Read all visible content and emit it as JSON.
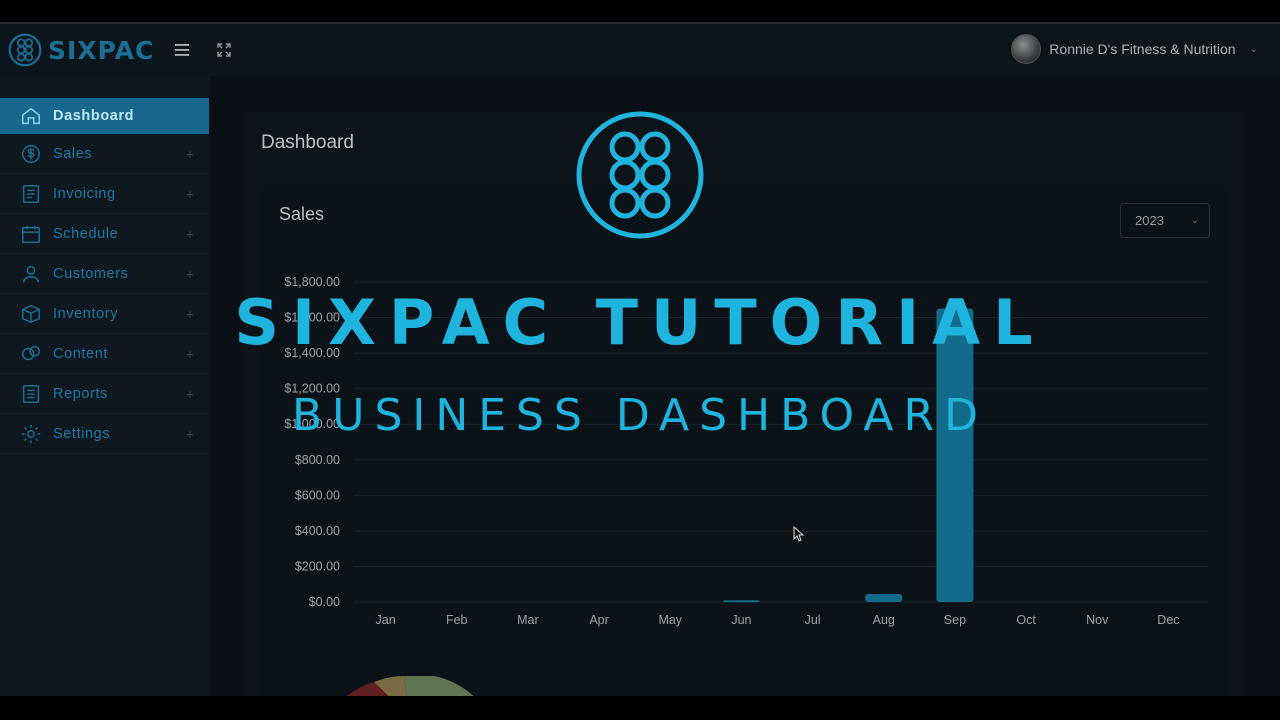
{
  "header": {
    "brand": "SIXPAC",
    "menu_icon": "hamburger-icon",
    "fullscreen_icon": "expand-icon",
    "user_name": "Ronnie D's Fitness & Nutrition"
  },
  "sidebar": {
    "items": [
      {
        "label": "Dashboard",
        "icon": "home-icon",
        "active": true
      },
      {
        "label": "Sales",
        "icon": "dollar-icon"
      },
      {
        "label": "Invoicing",
        "icon": "invoice-icon"
      },
      {
        "label": "Schedule",
        "icon": "calendar-icon"
      },
      {
        "label": "Customers",
        "icon": "user-icon"
      },
      {
        "label": "Inventory",
        "icon": "box-icon"
      },
      {
        "label": "Content",
        "icon": "content-icon"
      },
      {
        "label": "Reports",
        "icon": "report-icon"
      },
      {
        "label": "Settings",
        "icon": "gear-icon"
      }
    ],
    "expand_symbol": "+"
  },
  "main": {
    "page_title": "Dashboard",
    "sales_title": "Sales",
    "year": "2023"
  },
  "overlay": {
    "title": "SIXPAC TUTORIAL",
    "subtitle": "BUSINESS DASHBOARD"
  },
  "colors": {
    "accent": "#1fb4dd",
    "bar": "#136b8c",
    "brand": "#1b6f95"
  },
  "chart_data": {
    "type": "bar",
    "categories": [
      "Jan",
      "Feb",
      "Mar",
      "Apr",
      "May",
      "Jun",
      "Jul",
      "Aug",
      "Sep",
      "Oct",
      "Nov",
      "Dec"
    ],
    "values": [
      0,
      0,
      0,
      0,
      0,
      10,
      0,
      45,
      1650,
      0,
      0,
      0
    ],
    "yticks": [
      "$0.00",
      "$200.00",
      "$400.00",
      "$600.00",
      "$800.00",
      "$1,000.00",
      "$1,200.00",
      "$1,400.00",
      "$1,600.00",
      "$1,800.00"
    ],
    "ylim": [
      0,
      1800
    ],
    "grid": true
  }
}
